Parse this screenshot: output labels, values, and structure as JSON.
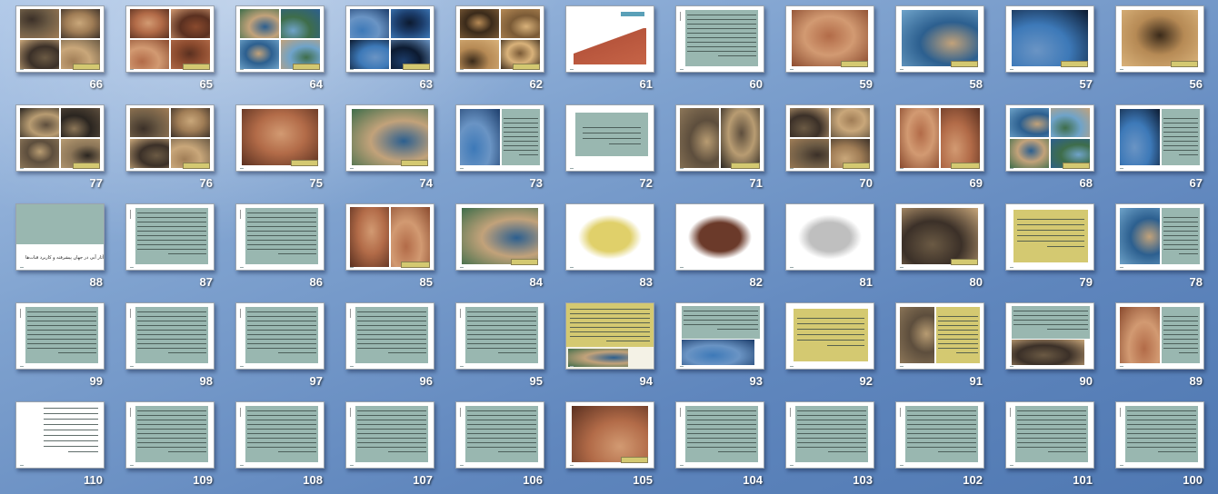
{
  "window": {
    "view": "slide-sorter"
  },
  "colors": {
    "teal": "#99b7b0",
    "yellow": "#d4c971",
    "background": "#5f86bd",
    "number": "#ffffff"
  },
  "slides": [
    {
      "n": "66",
      "layout": "photos4"
    },
    {
      "n": "65",
      "layout": "photos4"
    },
    {
      "n": "64",
      "layout": "photos4"
    },
    {
      "n": "63",
      "layout": "photos4"
    },
    {
      "n": "62",
      "layout": "photos4"
    },
    {
      "n": "61",
      "layout": "diagram"
    },
    {
      "n": "60",
      "layout": "teal-full"
    },
    {
      "n": "59",
      "layout": "photo1"
    },
    {
      "n": "58",
      "layout": "photo1"
    },
    {
      "n": "57",
      "layout": "photo1"
    },
    {
      "n": "56",
      "layout": "photo1"
    },
    {
      "n": "77",
      "layout": "photos4"
    },
    {
      "n": "76",
      "layout": "photos4"
    },
    {
      "n": "75",
      "layout": "photo1"
    },
    {
      "n": "74",
      "layout": "photo1"
    },
    {
      "n": "73",
      "layout": "photo-text"
    },
    {
      "n": "72",
      "layout": "teal-center"
    },
    {
      "n": "71",
      "layout": "photos2"
    },
    {
      "n": "70",
      "layout": "photos4"
    },
    {
      "n": "69",
      "layout": "photos2"
    },
    {
      "n": "68",
      "layout": "photos4"
    },
    {
      "n": "67",
      "layout": "photo-text"
    },
    {
      "n": "88",
      "layout": "title-block",
      "text": "آثار آبی در جهان پیشرفته و کاربرد قنات‌ها"
    },
    {
      "n": "87",
      "layout": "teal-full"
    },
    {
      "n": "86",
      "layout": "teal-full"
    },
    {
      "n": "85",
      "layout": "photos2"
    },
    {
      "n": "84",
      "layout": "photo1"
    },
    {
      "n": "83",
      "layout": "map"
    },
    {
      "n": "82",
      "layout": "map"
    },
    {
      "n": "81",
      "layout": "map"
    },
    {
      "n": "80",
      "layout": "photo1"
    },
    {
      "n": "79",
      "layout": "yellow-full"
    },
    {
      "n": "78",
      "layout": "photo-text"
    },
    {
      "n": "99",
      "layout": "teal-full"
    },
    {
      "n": "98",
      "layout": "teal-full"
    },
    {
      "n": "97",
      "layout": "teal-full"
    },
    {
      "n": "96",
      "layout": "teal-full"
    },
    {
      "n": "95",
      "layout": "teal-full"
    },
    {
      "n": "94",
      "layout": "yellow-photo"
    },
    {
      "n": "93",
      "layout": "teal-photo"
    },
    {
      "n": "92",
      "layout": "yellow-full"
    },
    {
      "n": "91",
      "layout": "photo-text-yellow"
    },
    {
      "n": "90",
      "layout": "teal-photo"
    },
    {
      "n": "89",
      "layout": "photo-text"
    },
    {
      "n": "110",
      "layout": "list"
    },
    {
      "n": "109",
      "layout": "teal-full"
    },
    {
      "n": "108",
      "layout": "teal-full"
    },
    {
      "n": "107",
      "layout": "teal-full"
    },
    {
      "n": "106",
      "layout": "teal-full"
    },
    {
      "n": "105",
      "layout": "photo1"
    },
    {
      "n": "104",
      "layout": "teal-full"
    },
    {
      "n": "103",
      "layout": "teal-full"
    },
    {
      "n": "102",
      "layout": "teal-full"
    },
    {
      "n": "101",
      "layout": "teal-full"
    },
    {
      "n": "100",
      "layout": "teal-full"
    }
  ]
}
